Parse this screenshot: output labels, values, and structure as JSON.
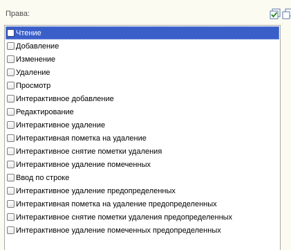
{
  "header": {
    "label": "Права:"
  },
  "items": [
    {
      "label": "Чтение",
      "checked": false,
      "selected": true
    },
    {
      "label": "Добавление",
      "checked": false,
      "selected": false
    },
    {
      "label": "Изменение",
      "checked": false,
      "selected": false
    },
    {
      "label": "Удаление",
      "checked": false,
      "selected": false
    },
    {
      "label": "Просмотр",
      "checked": false,
      "selected": false
    },
    {
      "label": "Интерактивное добавление",
      "checked": false,
      "selected": false
    },
    {
      "label": "Редактирование",
      "checked": false,
      "selected": false
    },
    {
      "label": "Интерактивное удаление",
      "checked": false,
      "selected": false
    },
    {
      "label": "Интерактивная пометка на удаление",
      "checked": false,
      "selected": false
    },
    {
      "label": "Интерактивное снятие пометки удаления",
      "checked": false,
      "selected": false
    },
    {
      "label": "Интерактивное удаление помеченных",
      "checked": false,
      "selected": false
    },
    {
      "label": "Ввод по строке",
      "checked": false,
      "selected": false
    },
    {
      "label": "Интерактивное удаление предопределенных",
      "checked": false,
      "selected": false
    },
    {
      "label": "Интерактивная пометка на удаление предопределенных",
      "checked": false,
      "selected": false
    },
    {
      "label": "Интерактивное снятие пометки удаления предопределенных",
      "checked": false,
      "selected": false
    },
    {
      "label": "Интерактивное удаление помеченных предопределенных",
      "checked": false,
      "selected": false
    }
  ],
  "icons": {
    "check_all": "check-all-icon",
    "copy": "copy-icon"
  },
  "colors": {
    "selection": "#3a5fc9",
    "background": "#fbfbf1"
  }
}
